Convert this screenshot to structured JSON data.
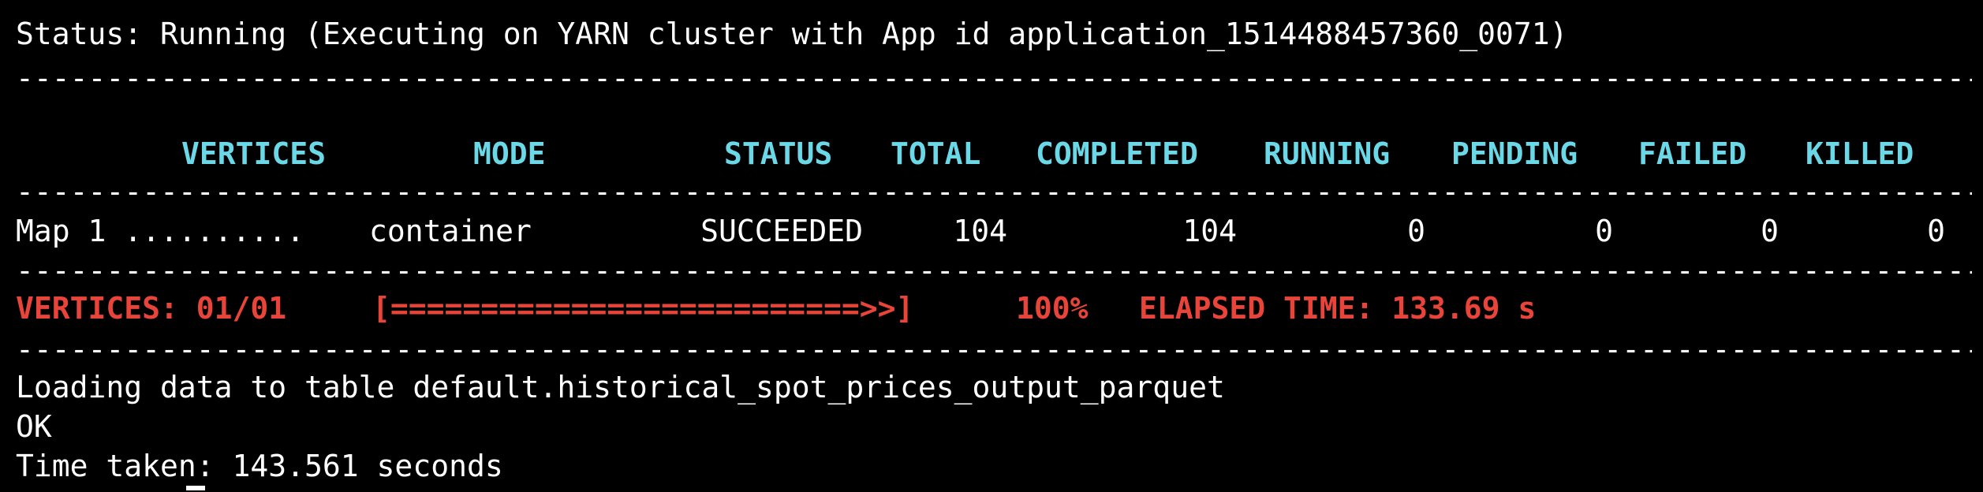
{
  "status_line": "Status: Running (Executing on YARN cluster with App id application_1514488457360_0071)",
  "separator": "--------------------------------------------------------------------------------------------------------------------------------------------------------------------------------",
  "table": {
    "headers": {
      "vertices": "VERTICES",
      "mode": "MODE",
      "status": "STATUS",
      "total": "TOTAL",
      "completed": "COMPLETED",
      "running": "RUNNING",
      "pending": "PENDING",
      "failed": "FAILED",
      "killed": "KILLED"
    },
    "rows": [
      {
        "vertex": "Map 1 ..........",
        "mode": "container",
        "status": "SUCCEEDED",
        "total": "104",
        "completed": "104",
        "running": "0",
        "pending": "0",
        "failed": "0",
        "killed": "0"
      }
    ]
  },
  "progress": {
    "vertices": "VERTICES: 01/01",
    "bar": "[==========================>>]",
    "percent": "100%",
    "fraction": 1.0,
    "elapsed": "ELAPSED TIME: 133.69 s"
  },
  "output": {
    "loading": "Loading data to table default.historical_spot_prices_output_parquet",
    "ok": "OK",
    "time_taken": "Time taken: 143.561 seconds"
  },
  "colors": {
    "background": "#000000",
    "text": "#ffffff",
    "header": "#6ad8e6",
    "progress": "#e8443a"
  }
}
